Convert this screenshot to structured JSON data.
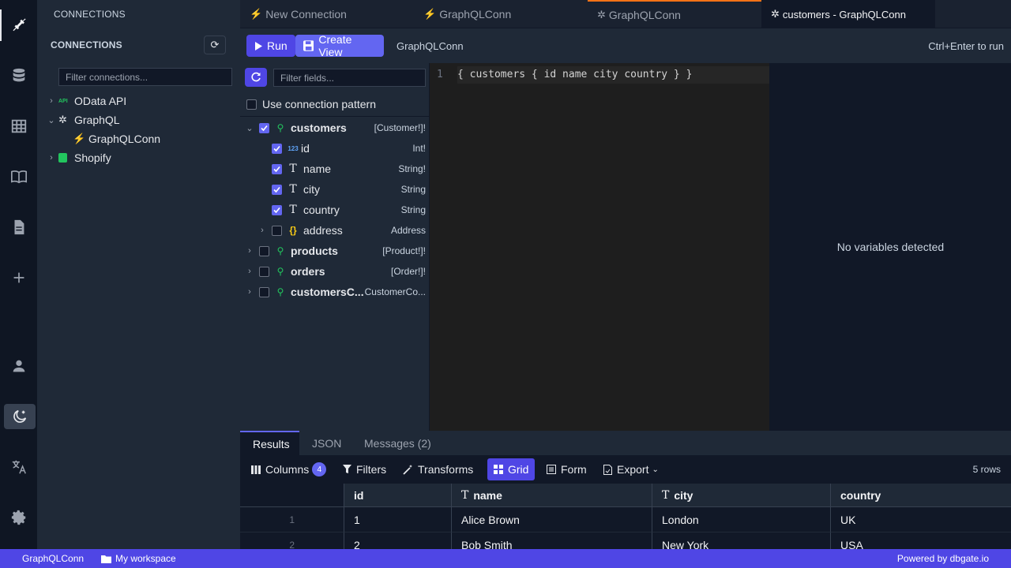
{
  "connections_panel": {
    "header": "CONNECTIONS",
    "title": "CONNECTIONS",
    "filter_placeholder": "Filter connections...",
    "tree": [
      {
        "label": "OData API",
        "icon": "api-icon",
        "expanded": false
      },
      {
        "label": "GraphQL",
        "icon": "graphql-icon",
        "expanded": true
      },
      {
        "label": "GraphQLConn",
        "icon": "plug-icon"
      },
      {
        "label": "Shopify",
        "icon": "shopify-icon",
        "expanded": false
      }
    ],
    "api_badge": "API"
  },
  "tabs": [
    {
      "label": "New Connection",
      "icon": "plug-icon"
    },
    {
      "label": "GraphQLConn",
      "icon": "plug-icon"
    },
    {
      "label": "GraphQLConn",
      "icon": "graphql-icon"
    },
    {
      "label": "customers - GraphQLConn",
      "icon": "graphql-icon",
      "active": true
    }
  ],
  "toolbar": {
    "run_label": "Run",
    "create_view_label": "Create View",
    "connection_label": "GraphQLConn",
    "hint": "Ctrl+Enter to run"
  },
  "fields_panel": {
    "filter_placeholder": "Filter fields...",
    "use_pattern_label": "Use connection pattern",
    "int_icon_text": "123",
    "items": [
      {
        "name": "customers",
        "type": "[Customer!]!",
        "checked": true,
        "expanded": true
      },
      {
        "name": "id",
        "type": "Int!",
        "checked": true
      },
      {
        "name": "name",
        "type": "String!",
        "checked": true
      },
      {
        "name": "city",
        "type": "String",
        "checked": true
      },
      {
        "name": "country",
        "type": "String",
        "checked": true
      },
      {
        "name": "address",
        "type": "Address",
        "checked": false
      },
      {
        "name": "products",
        "type": "[Product!]!",
        "checked": false
      },
      {
        "name": "orders",
        "type": "[Order!]!",
        "checked": false
      },
      {
        "name": "customersC...",
        "type": "CustomerCo...",
        "checked": false
      }
    ]
  },
  "editor": {
    "line_number": "1",
    "code": "{ customers { id name city country } }"
  },
  "variables_panel": {
    "empty_text": "No variables detected"
  },
  "result_tabs": [
    {
      "label": "Results",
      "active": true
    },
    {
      "label": "JSON"
    },
    {
      "label": "Messages (2)"
    }
  ],
  "result_toolbar": {
    "columns_label": "Columns",
    "columns_count": "4",
    "filters_label": "Filters",
    "transforms_label": "Transforms",
    "grid_label": "Grid",
    "form_label": "Form",
    "export_label": "Export",
    "row_count": "5 rows"
  },
  "grid": {
    "columns": [
      "id",
      "name",
      "city",
      "country"
    ],
    "rows": [
      {
        "num": "1",
        "cells": [
          "1",
          "Alice Brown",
          "London",
          "UK"
        ]
      },
      {
        "num": "2",
        "cells": [
          "2",
          "Bob Smith",
          "New York",
          "USA"
        ]
      }
    ]
  },
  "status_bar": {
    "connection": "GraphQLConn",
    "workspace": "My workspace",
    "powered": "Powered by dbgate.io"
  },
  "colors": {
    "accent": "#4f46e5",
    "active_tab_marker": "#f97316",
    "search_icon": "#22c55e",
    "shopify": "#22c55e"
  }
}
